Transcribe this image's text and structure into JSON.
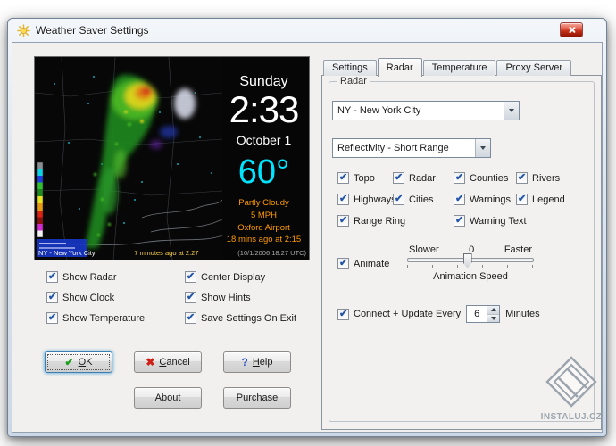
{
  "window": {
    "title": "Weather Saver Settings"
  },
  "preview": {
    "day": "Sunday",
    "time": "2:33",
    "date": "October 1",
    "temperature": "60°",
    "conditions": "Partly Cloudy",
    "wind": "5 MPH",
    "station": "Oxford Airport",
    "updated": "18 mins ago at 2:15",
    "status_left": "NY - New York City",
    "status_mid": "7 minutes ago at 2:27",
    "status_right": "(10/1/2006 18:27 UTC)",
    "accent_color": "#00e4ff",
    "info_color": "#ff9b00"
  },
  "display_options": {
    "items": [
      {
        "label": "Show Radar",
        "checked": true
      },
      {
        "label": "Center Display",
        "checked": true
      },
      {
        "label": "Show Clock",
        "checked": true
      },
      {
        "label": "Show Hints",
        "checked": true
      },
      {
        "label": "Show Temperature",
        "checked": true
      },
      {
        "label": "Save Settings On Exit",
        "checked": true
      }
    ]
  },
  "buttons": {
    "ok": "OK",
    "ok_icon": "✔",
    "cancel": "Cancel",
    "cancel_icon": "✖",
    "help": "Help",
    "help_icon": "?",
    "about": "About",
    "purchase": "Purchase"
  },
  "tabs": [
    {
      "label": "Settings",
      "active": false
    },
    {
      "label": "Radar",
      "active": true
    },
    {
      "label": "Temperature",
      "active": false
    },
    {
      "label": "Proxy Server",
      "active": false
    }
  ],
  "radar_tab": {
    "group_title": "Radar",
    "location_value": "NY - New York City",
    "product_value": "Reflectivity - Short Range",
    "layers": [
      {
        "label": "Topo",
        "checked": true
      },
      {
        "label": "Radar",
        "checked": true
      },
      {
        "label": "Counties",
        "checked": true
      },
      {
        "label": "Rivers",
        "checked": true
      },
      {
        "label": "Highways",
        "checked": true
      },
      {
        "label": "Cities",
        "checked": true
      },
      {
        "label": "Warnings",
        "checked": true
      },
      {
        "label": "Legend",
        "checked": true
      },
      {
        "label": "Range Ring",
        "checked": true
      },
      {
        "label": "Warning Text",
        "checked": true
      }
    ],
    "animate": {
      "label": "Animate",
      "checked": true,
      "slower": "Slower",
      "zero": "0",
      "faster": "Faster",
      "caption": "Animation Speed"
    },
    "update": {
      "label": "Connect + Update Every",
      "checked": true,
      "value": "6",
      "unit": "Minutes"
    }
  },
  "watermark": {
    "text": "INSTALUJ.CZ"
  }
}
